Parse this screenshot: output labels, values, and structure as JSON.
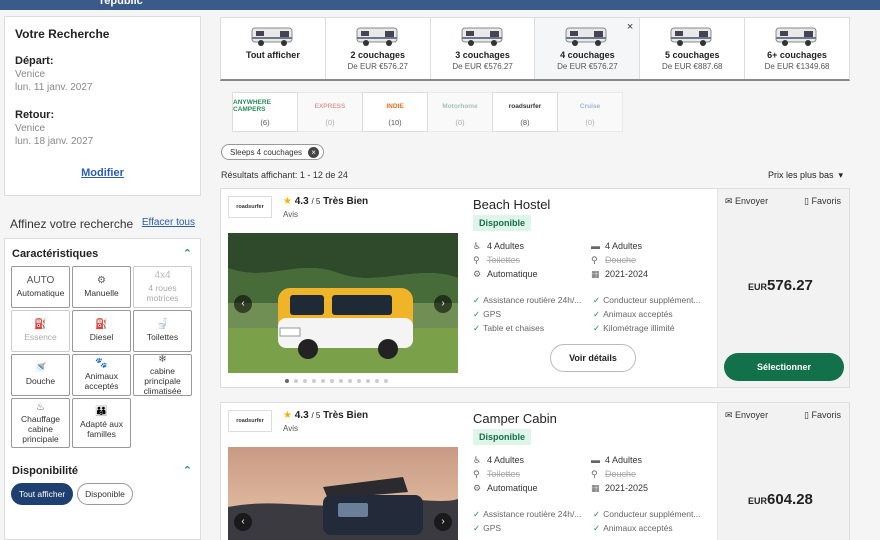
{
  "header": {
    "brand_fragment": "republic"
  },
  "search": {
    "title": "Votre Recherche",
    "departure_label": "Départ:",
    "departure_location": "Venice",
    "departure_date": "lun. 11 janv. 2027",
    "return_label": "Retour:",
    "return_location": "Venice",
    "return_date": "lun. 18 janv. 2027",
    "modify_label": "Modifier"
  },
  "refine": {
    "title": "Affinez votre recherche",
    "clear_label": "Effacer tous"
  },
  "features": {
    "title": "Caractéristiques",
    "items": [
      {
        "label": "Automatique",
        "icon": "AUTO",
        "enabled": true
      },
      {
        "label": "Manuelle",
        "icon": "⚙",
        "enabled": true
      },
      {
        "label": "4 roues motrices",
        "icon": "4x4",
        "enabled": false
      },
      {
        "label": "Essence",
        "icon": "⛽",
        "enabled": false
      },
      {
        "label": "Diesel",
        "icon": "⛽",
        "enabled": true
      },
      {
        "label": "Toilettes",
        "icon": "🚽",
        "enabled": true
      },
      {
        "label": "Douche",
        "icon": "🚿",
        "enabled": true
      },
      {
        "label": "Animaux acceptés",
        "icon": "🐾",
        "enabled": true
      },
      {
        "label": "cabine principale climatisée",
        "icon": "❄",
        "enabled": true
      },
      {
        "label": "Chauffage cabine principale",
        "icon": "♨",
        "enabled": true
      },
      {
        "label": "Adapté aux familles",
        "icon": "👪",
        "enabled": true
      }
    ]
  },
  "availability": {
    "title": "Disponibilité",
    "options": [
      {
        "label": "Tout afficher",
        "active": true
      },
      {
        "label": "Disponible",
        "active": false
      }
    ]
  },
  "vehicle_tabs": [
    {
      "name": "Tout afficher",
      "price": "",
      "selected": false
    },
    {
      "name": "2 couchages",
      "price": "De EUR €576.27",
      "selected": false
    },
    {
      "name": "3 couchages",
      "price": "De EUR €576.27",
      "selected": false
    },
    {
      "name": "4 couchages",
      "price": "De EUR €576.27",
      "selected": true
    },
    {
      "name": "5 couchages",
      "price": "De EUR €887.68",
      "selected": false
    },
    {
      "name": "6+ couchages",
      "price": "De EUR €1349.68",
      "selected": false
    }
  ],
  "brands": [
    {
      "logo": "ANYWHERE CAMPERS",
      "count": "(6)",
      "enabled": true,
      "color": "#2a8a5c"
    },
    {
      "logo": "EXPRESS",
      "count": "(0)",
      "enabled": false,
      "color": "#c0392b"
    },
    {
      "logo": "INDIE",
      "count": "(10)",
      "enabled": true,
      "color": "#e46b1a"
    },
    {
      "logo": "Motorhome",
      "count": "(0)",
      "enabled": false,
      "color": "#3a8a5c"
    },
    {
      "logo": "roadsurfer",
      "count": "(8)",
      "enabled": true,
      "color": "#333333"
    },
    {
      "logo": "Cruise",
      "count": "(0)",
      "enabled": false,
      "color": "#2a6cb0"
    }
  ],
  "active_filter": {
    "label": "Sleeps 4 couchages"
  },
  "results": {
    "text": "Résultats affichant: 1 - 12 de 24",
    "sort_label": "Prix les plus bas"
  },
  "listings": [
    {
      "brand": "roadsurfer",
      "rating": "4.3",
      "rating_scale": "/ 5",
      "rating_word": "Très Bien",
      "reviews_label": "Avis",
      "title": "Beach Hostel",
      "status": "Disponible",
      "specs": [
        {
          "icon": "♿",
          "text": "4 Adultes",
          "struck": false
        },
        {
          "icon": "▬",
          "text": "4 Adultes",
          "struck": false
        },
        {
          "icon": "⚲",
          "text": "Toilettes",
          "struck": true
        },
        {
          "icon": "⚲",
          "text": "Douche",
          "struck": true
        },
        {
          "icon": "⚙",
          "text": "Automatique",
          "struck": false
        },
        {
          "icon": "▦",
          "text": "2021-2024",
          "struck": false
        }
      ],
      "features": [
        "Assistance routière 24h/...",
        "Conducteur supplément...",
        "GPS",
        "Animaux acceptés",
        "Table et chaises",
        "Kilométrage illimité"
      ],
      "details_label": "Voir détails",
      "send_label": "Envoyer",
      "fav_label": "Favoris",
      "currency": "EUR",
      "price": "576.27",
      "select_label": "Sélectionner"
    },
    {
      "brand": "roadsurfer",
      "rating": "4.3",
      "rating_scale": "/ 5",
      "rating_word": "Très Bien",
      "reviews_label": "Avis",
      "title": "Camper Cabin",
      "status": "Disponible",
      "specs": [
        {
          "icon": "♿",
          "text": "4 Adultes",
          "struck": false
        },
        {
          "icon": "▬",
          "text": "4 Adultes",
          "struck": false
        },
        {
          "icon": "⚲",
          "text": "Toilettes",
          "struck": true
        },
        {
          "icon": "⚲",
          "text": "Douche",
          "struck": true
        },
        {
          "icon": "⚙",
          "text": "Automatique",
          "struck": false
        },
        {
          "icon": "▦",
          "text": "2021-2025",
          "struck": false
        }
      ],
      "features": [
        "Assistance routière 24h/...",
        "Conducteur supplément...",
        "GPS",
        "Animaux acceptés"
      ],
      "send_label": "Envoyer",
      "fav_label": "Favoris",
      "currency": "EUR",
      "price": "604.28"
    }
  ]
}
